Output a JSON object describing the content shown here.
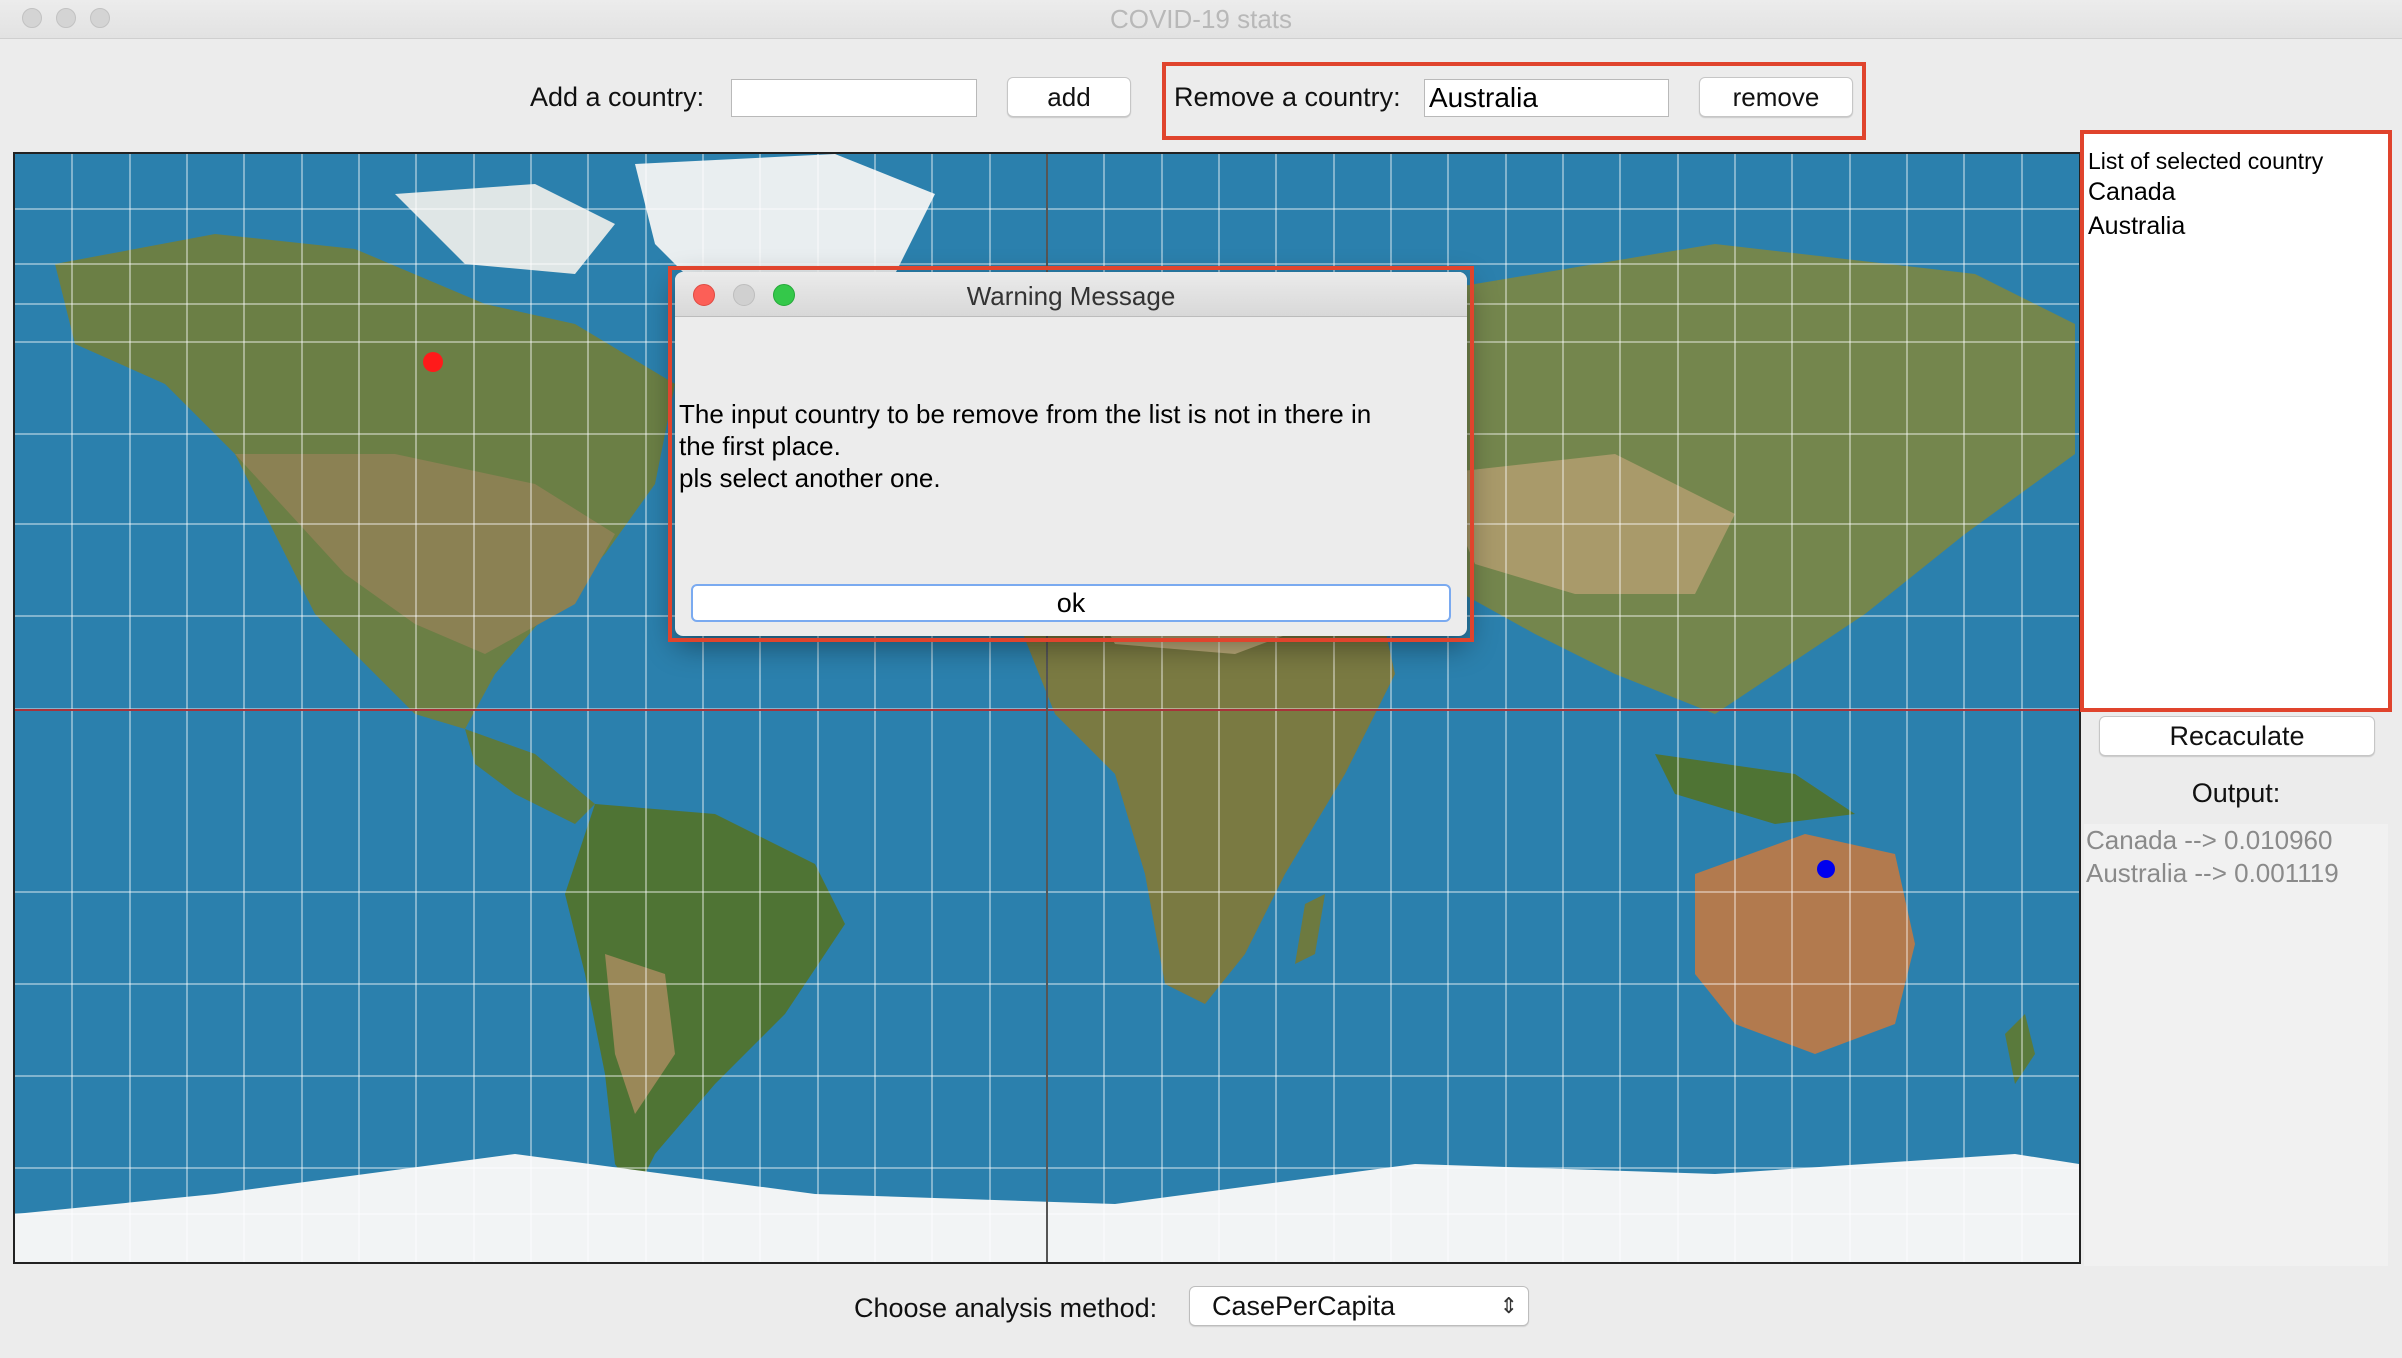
{
  "window": {
    "title": "COVID-19 stats"
  },
  "add": {
    "label": "Add a country:",
    "value": "",
    "button": "add"
  },
  "remove": {
    "label": "Remove a country:",
    "value": "Australia",
    "button": "remove"
  },
  "selected": {
    "header": "List of selected country",
    "items": [
      "Canada",
      "Australia"
    ]
  },
  "recalc": {
    "button": "Recaculate"
  },
  "output": {
    "label": "Output:",
    "lines": [
      "Canada --> 0.010960",
      "Australia --> 0.001119"
    ]
  },
  "method": {
    "label": "Choose analysis method:",
    "value": "CasePerCapita"
  },
  "dialog": {
    "title": "Warning Message",
    "line1": "The input country to be remove from the list is not in there in",
    "line2": "the first place.",
    "line3": "pls select another one.",
    "ok": "ok"
  },
  "colors": {
    "highlight": "#e0442d",
    "canada_marker": "#ff1a1a",
    "australia_marker": "#0000ee"
  },
  "map": {
    "markers": [
      {
        "country": "Canada",
        "color": "red"
      },
      {
        "country": "Australia",
        "color": "blue"
      }
    ]
  }
}
